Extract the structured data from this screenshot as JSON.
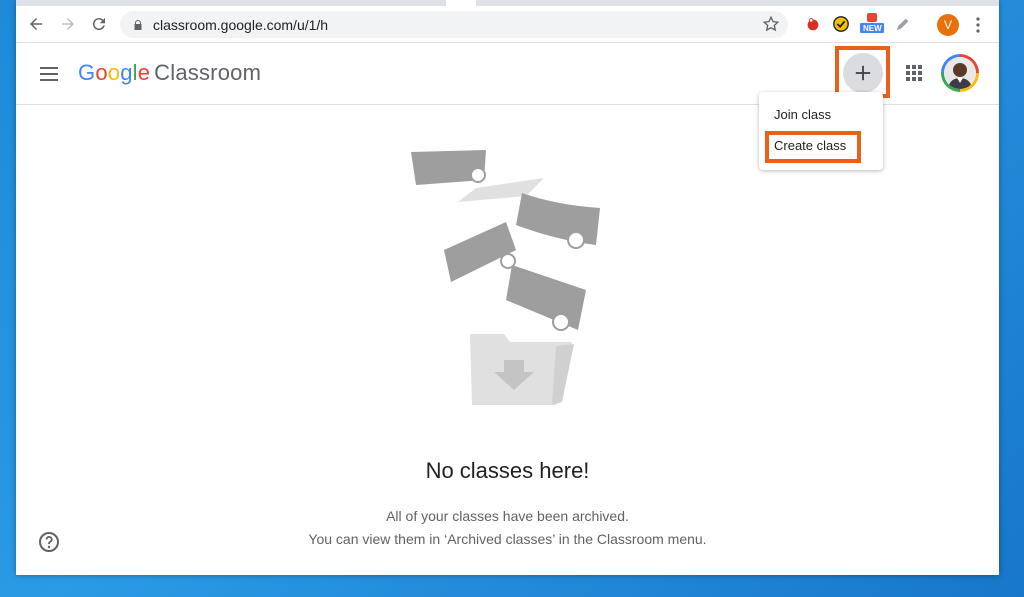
{
  "browser": {
    "url": "classroom.google.com/u/1/h",
    "profile_initial": "V",
    "extensions": [
      "record-icon",
      "norton-icon",
      "new-badge-icon",
      "pen-icon"
    ],
    "ext_new_label": "NEW"
  },
  "app": {
    "logo_letters": [
      "G",
      "o",
      "o",
      "g",
      "l",
      "e"
    ],
    "product": "Classroom"
  },
  "menu": {
    "join_label": "Join class",
    "create_label": "Create class"
  },
  "empty": {
    "title": "No classes here!",
    "line1": "All of your classes have been archived.",
    "line2": "You can view them in ‘Archived classes’ in the Classroom menu."
  },
  "colors": {
    "highlight": "#e8601c",
    "google_blue": "#4285f4",
    "google_red": "#ea4335",
    "google_yellow": "#fbbc05",
    "google_green": "#34a853"
  }
}
